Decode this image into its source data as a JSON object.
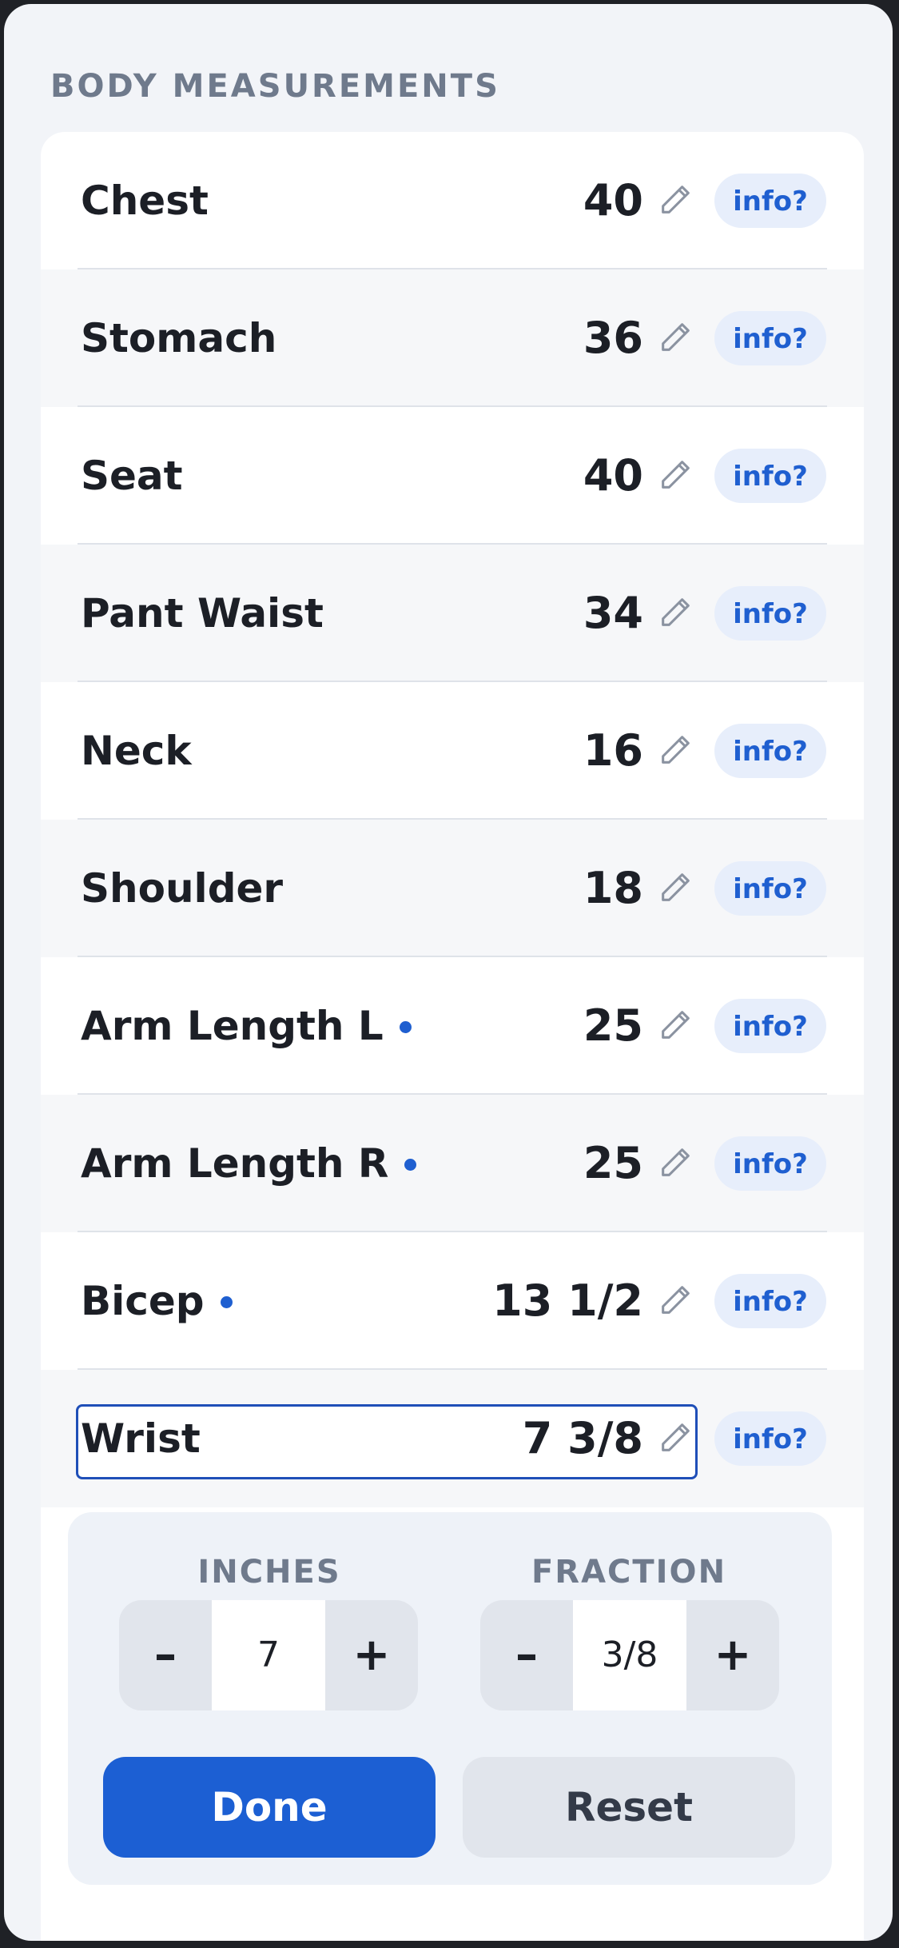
{
  "section_title": "BODY MEASUREMENTS",
  "info_label": "info?",
  "rows": [
    {
      "label": "Chest",
      "value": "40",
      "dot": false
    },
    {
      "label": "Stomach",
      "value": "36",
      "dot": false
    },
    {
      "label": "Seat",
      "value": "40",
      "dot": false
    },
    {
      "label": "Pant Waist",
      "value": "34",
      "dot": false
    },
    {
      "label": "Neck",
      "value": "16",
      "dot": false
    },
    {
      "label": "Shoulder",
      "value": "18",
      "dot": false
    },
    {
      "label": "Arm Length L",
      "value": "25",
      "dot": true
    },
    {
      "label": "Arm Length R",
      "value": "25",
      "dot": true
    },
    {
      "label": "Bicep",
      "value": "13 1/2",
      "dot": true
    },
    {
      "label": "Wrist",
      "value": "7 3/8",
      "dot": false,
      "selected": true
    }
  ],
  "editor": {
    "inches_label": "INCHES",
    "fraction_label": "FRACTION",
    "inches_value": "7",
    "fraction_value": "3/8",
    "minus": "–",
    "plus": "+",
    "done_label": "Done",
    "reset_label": "Reset"
  },
  "colors": {
    "accent": "#1c5fd3",
    "dot": "#1f5fd0",
    "info_bg": "#e7eefb"
  },
  "icons": {
    "edit": "pencil-icon",
    "modified": "dot-indicator"
  }
}
